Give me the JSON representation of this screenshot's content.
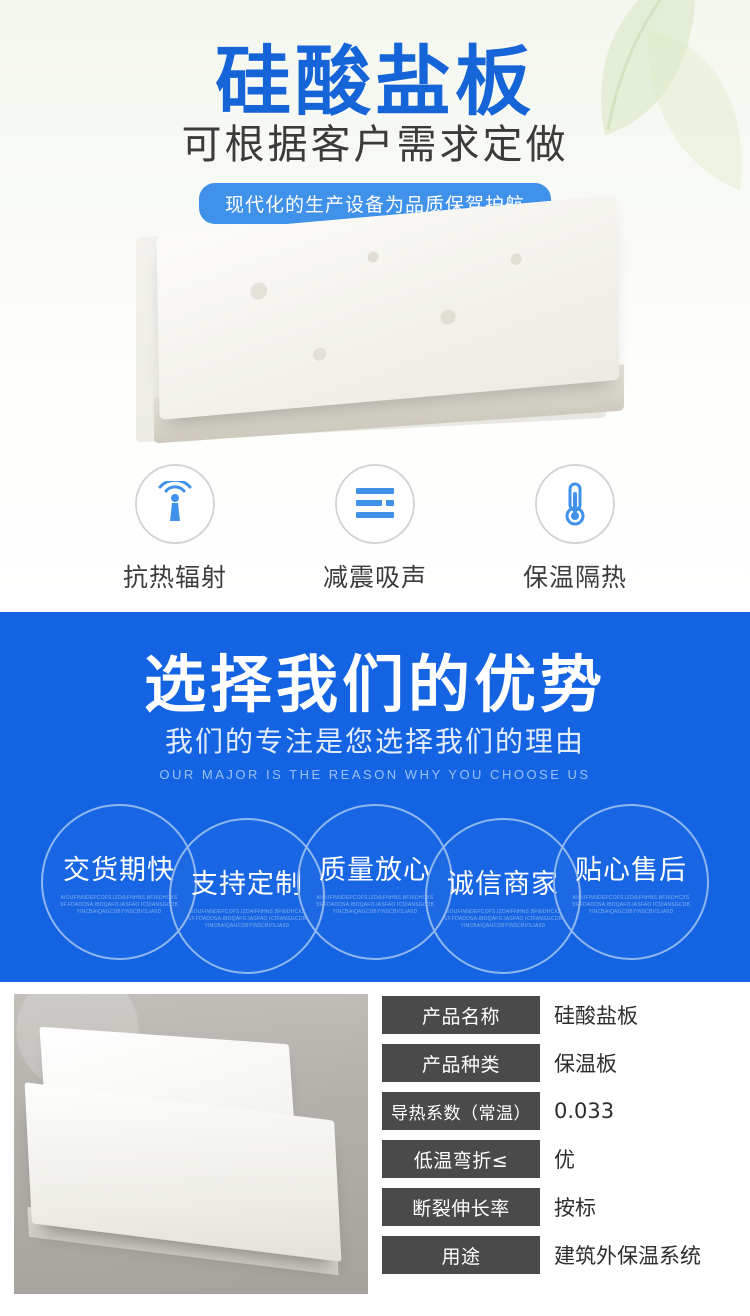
{
  "hero": {
    "title": "硅酸盐板",
    "subtitle": "可根据客户需求定做",
    "pill": "现代化的生产设备为品质保驾护航",
    "features": [
      {
        "icon": "radiation-waves-icon",
        "label": "抗热辐射"
      },
      {
        "icon": "sound-bars-icon",
        "label": "减震吸声"
      },
      {
        "icon": "thermometer-icon",
        "label": "保温隔热"
      }
    ]
  },
  "advantages": {
    "title": "选择我们的优势",
    "subtitle": "我们的专注是您选择我们的理由",
    "english": "OUR MAJOR IS THE REASON WHY YOU CHOOSE US",
    "items": [
      {
        "label": "交货期快",
        "micro": "AIOUFINNDEPCOFS.IZDAIFNHNS BFNIDHCXS SF.FDADDSA.IBDQAFO.IASFAO ICDIANSGCDBYINCBAIQAGCDBYINSCBVS.IAIID"
      },
      {
        "label": "支持定制",
        "micro": "AIOUFINNDEPCOFS.IZDAIFNHNS BFNIDHCXS SF.FDADDSA.IBDQAFO.IASFAO ICDIANSGCDBYINCBAIQAGCDBYINSCBVS.IAIID"
      },
      {
        "label": "质量放心",
        "micro": "AIOUFINNDEPCOFS.IZDAIFNHNS BFNIDHCXS SF.FDADDSA.IBDQAFO.IASFAO ICDIANSGCDBYINCBAIQAGCDBYINSCBVS.IAIID"
      },
      {
        "label": "诚信商家",
        "micro": "AIOUFINNDEPCOFS.IZDAIFNHNS BFNIDHCXS SF.FDADDSA.IBDQAFO.IASFAO ICDIANSGCDBYINCBAIQAGCDBYINSCBVS.IAIID"
      },
      {
        "label": "贴心售后",
        "micro": "AIOUFINNDEPCOFS.IZDAIFNHNS BFNIDHCXS SF.FDADDSA.IBDQAFO.IASFAO ICDIANSGCDBYINCBAIQAGCDBYINSCBVS.IAIID"
      }
    ],
    "bg_color": "#1463e3"
  },
  "specs": {
    "rows": [
      {
        "key": "产品名称",
        "value": "硅酸盐板"
      },
      {
        "key": "产品种类",
        "value": "保温板"
      },
      {
        "key": "导热系数（常温）",
        "value": "0.033"
      },
      {
        "key": "低温弯折≤",
        "value": "优"
      },
      {
        "key": "断裂伸长率",
        "value": "按标"
      },
      {
        "key": "用途",
        "value": "建筑外保温系统"
      }
    ],
    "key_bg": "#4a4a4a"
  },
  "colors": {
    "brand_blue": "#1565d8",
    "section_blue": "#1463e3",
    "icon_blue": "#3f91ea"
  }
}
